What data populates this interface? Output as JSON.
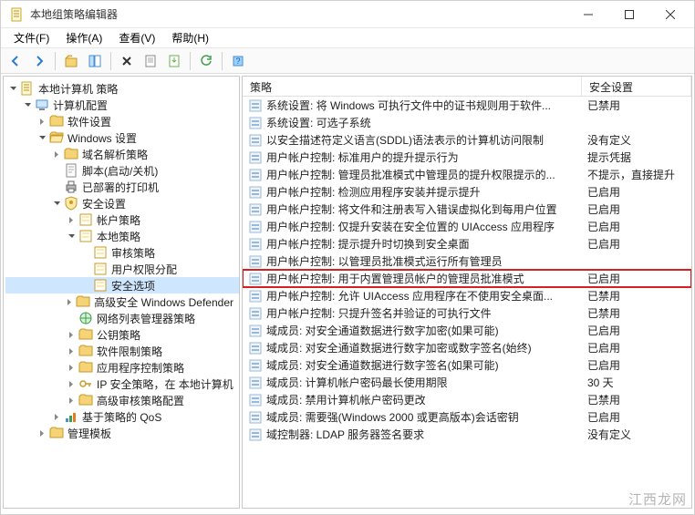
{
  "window": {
    "title": "本地组策略编辑器"
  },
  "menu": {
    "file": "文件(F)",
    "action": "操作(A)",
    "view": "查看(V)",
    "help": "帮助(H)"
  },
  "tree": {
    "root": "本地计算机 策略",
    "computer_config": "计算机配置",
    "software_settings": "软件设置",
    "windows_settings": "Windows 设置",
    "name_resolution": "域名解析策略",
    "scripts": "脚本(启动/关机)",
    "deployed_printers": "已部署的打印机",
    "security_settings": "安全设置",
    "account_policies": "帐户策略",
    "local_policies": "本地策略",
    "audit_policy": "审核策略",
    "user_rights": "用户权限分配",
    "security_options": "安全选项",
    "adv_windows_defender": "高级安全 Windows Defender",
    "network_list": "网络列表管理器策略",
    "public_key": "公钥策略",
    "software_restrict": "软件限制策略",
    "app_control": "应用程序控制策略",
    "ip_security": "IP 安全策略，在 本地计算机",
    "adv_audit": "高级审核策略配置",
    "policy_qos": "基于策略的 QoS",
    "admin_templates": "管理模板"
  },
  "list": {
    "col_policy": "策略",
    "col_setting": "安全设置",
    "rows": [
      {
        "name": "系统设置: 将 Windows 可执行文件中的证书规则用于软件...",
        "setting": "已禁用"
      },
      {
        "name": "系统设置: 可选子系统",
        "setting": ""
      },
      {
        "name": "以安全描述符定义语言(SDDL)语法表示的计算机访问限制",
        "setting": "没有定义"
      },
      {
        "name": "用户帐户控制: 标准用户的提升提示行为",
        "setting": "提示凭据"
      },
      {
        "name": "用户帐户控制: 管理员批准模式中管理员的提升权限提示的...",
        "setting": "不提示，直接提升"
      },
      {
        "name": "用户帐户控制: 检测应用程序安装并提示提升",
        "setting": "已启用"
      },
      {
        "name": "用户帐户控制: 将文件和注册表写入错误虚拟化到每用户位置",
        "setting": "已启用"
      },
      {
        "name": "用户帐户控制: 仅提升安装在安全位置的 UIAccess 应用程序",
        "setting": "已启用"
      },
      {
        "name": "用户帐户控制: 提示提升时切换到安全桌面",
        "setting": "已启用"
      },
      {
        "name": "用户帐户控制: 以管理员批准模式运行所有管理员",
        "setting": ""
      },
      {
        "name": "用户帐户控制: 用于内置管理员帐户的管理员批准模式",
        "setting": "已启用",
        "highlight": true
      },
      {
        "name": "用户帐户控制: 允许 UIAccess 应用程序在不使用安全桌面...",
        "setting": "已禁用"
      },
      {
        "name": "用户帐户控制: 只提升签名并验证的可执行文件",
        "setting": "已禁用"
      },
      {
        "name": "域成员: 对安全通道数据进行数字加密(如果可能)",
        "setting": "已启用"
      },
      {
        "name": "域成员: 对安全通道数据进行数字加密或数字签名(始终)",
        "setting": "已启用"
      },
      {
        "name": "域成员: 对安全通道数据进行数字签名(如果可能)",
        "setting": "已启用"
      },
      {
        "name": "域成员: 计算机帐户密码最长使用期限",
        "setting": "30 天"
      },
      {
        "name": "域成员: 禁用计算机帐户密码更改",
        "setting": "已禁用"
      },
      {
        "name": "域成员: 需要强(Windows 2000 或更高版本)会话密钥",
        "setting": "已启用"
      },
      {
        "name": "域控制器: LDAP 服务器签名要求",
        "setting": "没有定义"
      }
    ]
  },
  "watermark": "江西龙网"
}
